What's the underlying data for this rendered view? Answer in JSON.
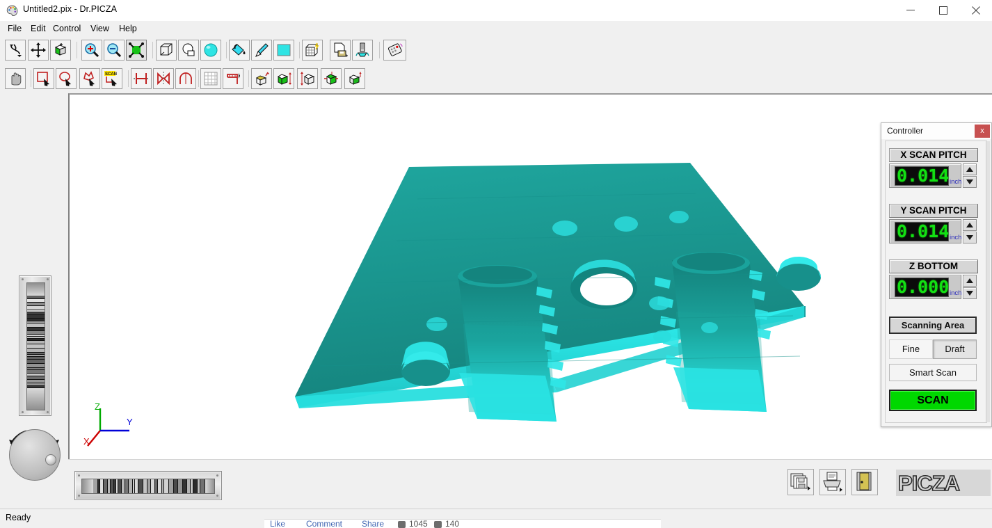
{
  "window": {
    "title": "Untitled2.pix - Dr.PICZA",
    "icon": "picza-palette-icon",
    "minimize_label": "–",
    "maximize_label": "□",
    "close_label": "×"
  },
  "menu": {
    "items": [
      {
        "label": "File"
      },
      {
        "label": "Edit"
      },
      {
        "label": "Control"
      },
      {
        "label": "View"
      },
      {
        "label": "Help"
      }
    ]
  },
  "toolbar_main": {
    "buttons": [
      {
        "name": "rotate-tool",
        "icon": "rotate-arrows-icon"
      },
      {
        "name": "pan-tool",
        "icon": "move-cross-icon"
      },
      {
        "name": "object-tool",
        "icon": "cube-green-icon"
      },
      {
        "name": "zoom-in",
        "icon": "magnifier-plus-icon"
      },
      {
        "name": "zoom-out",
        "icon": "magnifier-minus-icon"
      },
      {
        "name": "zoom-fit",
        "icon": "fit-selection-icon"
      },
      {
        "name": "wireframe-view",
        "icon": "wireframe-cube-icon"
      },
      {
        "name": "shaded-view",
        "icon": "sphere-outline-icon"
      },
      {
        "name": "render-view",
        "icon": "sphere-cyan-icon"
      },
      {
        "name": "fill-color-tool",
        "icon": "paint-bucket-icon"
      },
      {
        "name": "brush-tool",
        "icon": "paintbrush-icon"
      },
      {
        "name": "color-swatch",
        "icon": "color-swatch-cyan"
      },
      {
        "name": "mesh-tool",
        "icon": "mesh-cube-icon"
      },
      {
        "name": "save-as-tool",
        "icon": "save-document-icon"
      },
      {
        "name": "scanner-head-tool",
        "icon": "scanner-probe-icon"
      },
      {
        "name": "remote-tool",
        "icon": "remote-control-icon"
      }
    ]
  },
  "toolbar_edit": {
    "buttons": [
      {
        "name": "hand-tool",
        "icon": "hand-grab-icon"
      },
      {
        "name": "rect-select",
        "icon": "rect-select-icon"
      },
      {
        "name": "ellipse-select",
        "icon": "ellipse-select-icon"
      },
      {
        "name": "lasso-select",
        "icon": "lasso-select-icon"
      },
      {
        "name": "magic-scan-select",
        "icon": "scan-select-icon"
      },
      {
        "name": "split-surface",
        "icon": "split-h-icon"
      },
      {
        "name": "mirror-tool",
        "icon": "mirror-icon"
      },
      {
        "name": "arch-tool",
        "icon": "arch-icon"
      },
      {
        "name": "grid-tool",
        "icon": "grid-icon"
      },
      {
        "name": "table-tool",
        "icon": "table-icon"
      },
      {
        "name": "extrude-up",
        "icon": "cube-extrude-icon"
      },
      {
        "name": "height-adjust",
        "icon": "cube-height-icon"
      },
      {
        "name": "depth-adjust",
        "icon": "cube-depth-icon"
      },
      {
        "name": "scale-tool",
        "icon": "cube-scale-icon"
      },
      {
        "name": "offset-tool",
        "icon": "cube-offset-icon"
      }
    ]
  },
  "controller": {
    "title": "Controller",
    "close_label": "x",
    "fields": [
      {
        "name": "x-scan-pitch",
        "label": "X SCAN PITCH",
        "value": "0.014",
        "unit": "inch"
      },
      {
        "name": "y-scan-pitch",
        "label": "Y SCAN PITCH",
        "value": "0.014",
        "unit": "inch"
      },
      {
        "name": "z-bottom",
        "label": "Z BOTTOM",
        "value": "0.000",
        "unit": "inch"
      }
    ],
    "scanning_area_label": "Scanning Area",
    "quality": {
      "options": [
        "Fine",
        "Draft"
      ],
      "selected": "Draft"
    },
    "smart_scan_label": "Smart Scan",
    "scan_label": "SCAN",
    "scan_color": "#00d800",
    "lcd_color": "#13e013",
    "spin_up": "▲",
    "spin_down": "▼"
  },
  "viewport": {
    "axes": {
      "x_label": "X",
      "y_label": "Y",
      "z_label": "Z",
      "x_color": "#cc0000",
      "y_color": "#0000d8",
      "z_color": "#00aa00"
    },
    "model": {
      "name": "scanned-hinge-plate",
      "base_color": "#1d9c95",
      "highlight_color": "#22e6e6",
      "shadow_color": "#13736e"
    }
  },
  "bottom_bar": {
    "buttons": [
      {
        "name": "save-copies-button",
        "icon": "floppy-stack-icon"
      },
      {
        "name": "print-button",
        "icon": "printer-icon"
      },
      {
        "name": "exit-button",
        "icon": "exit-door-icon"
      }
    ],
    "logo_text": "PICZA"
  },
  "statusbar": {
    "text": "Ready"
  },
  "background_page": {
    "actions": [
      "Like",
      "Comment",
      "Share"
    ],
    "counts": [
      "1045",
      "140"
    ]
  }
}
